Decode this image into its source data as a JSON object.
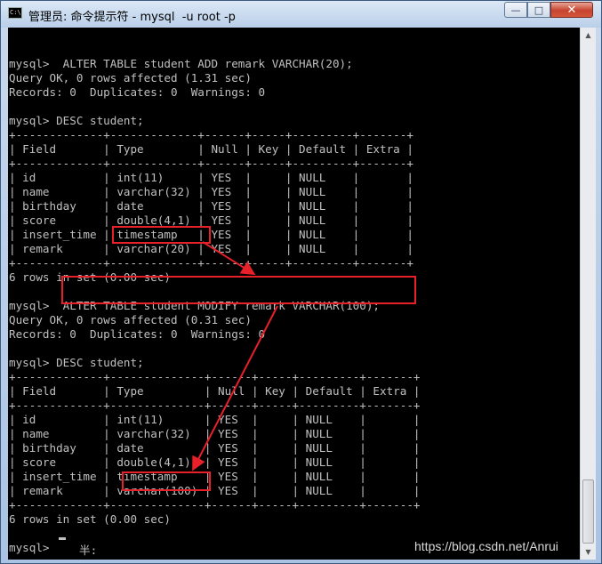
{
  "window": {
    "title": "管理员: 命令提示符 - mysql  -u root -p",
    "icon": "cmd-icon",
    "icon_text": "C:\\",
    "controls": {
      "minimize": "—",
      "maximize": "□",
      "close": "✕"
    }
  },
  "console": {
    "lines": [
      "",
      "mysql>  ALTER TABLE student ADD remark VARCHAR(20);",
      "Query OK, 0 rows affected (1.31 sec)",
      "Records: 0  Duplicates: 0  Warnings: 0",
      "",
      "mysql> DESC student;",
      "+-------------+-------------+------+-----+---------+-------+",
      "| Field       | Type        | Null | Key | Default | Extra |",
      "+-------------+-------------+------+-----+---------+-------+",
      "| id          | int(11)     | YES  |     | NULL    |       |",
      "| name        | varchar(32) | YES  |     | NULL    |       |",
      "| birthday    | date        | YES  |     | NULL    |       |",
      "| score       | double(4,1) | YES  |     | NULL    |       |",
      "| insert_time | timestamp   | YES  |     | NULL    |       |",
      "| remark      | varchar(20) | YES  |     | NULL    |       |",
      "+-------------+-------------+------+-----+---------+-------+",
      "6 rows in set (0.00 sec)",
      "",
      "mysql>  ALTER TABLE student MODIFY remark VARCHAR(100);",
      "Query OK, 0 rows affected (0.31 sec)",
      "Records: 0  Duplicates: 0  Warnings: 0",
      "",
      "mysql> DESC student;",
      "+-------------+--------------+------+-----+---------+-------+",
      "| Field       | Type         | Null | Key | Default | Extra |",
      "+-------------+--------------+------+-----+---------+-------+",
      "| id          | int(11)      | YES  |     | NULL    |       |",
      "| name        | varchar(32)  | YES  |     | NULL    |       |",
      "| birthday    | date         | YES  |     | NULL    |       |",
      "| score       | double(4,1)  | YES  |     | NULL    |       |",
      "| insert_time | timestamp    | YES  |     | NULL    |       |",
      "| remark      | varchar(100) | YES  |     | NULL    |       |",
      "+-------------+--------------+------+-----+---------+-------+",
      "6 rows in set (0.00 sec)",
      "",
      "mysql> "
    ],
    "ime_status": "半:"
  },
  "annotations": {
    "highlight_color": "#e8202a"
  },
  "watermark": "https://blog.csdn.net/Anrui"
}
